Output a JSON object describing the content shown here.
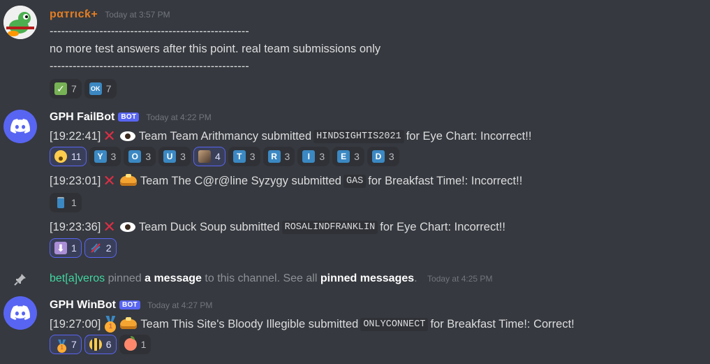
{
  "messages": [
    {
      "author": "pαтrιcƙ+",
      "timestamp": "Today at 3:57 PM",
      "lines": [
        "----------------------------------------------------",
        "no more test answers after this point. real team submissions only",
        "----------------------------------------------------"
      ],
      "reactions": [
        {
          "emoji": "check-mark-icon",
          "count": "7"
        },
        {
          "emoji": "ok-icon",
          "emoji_text": "OK",
          "count": "7"
        }
      ]
    },
    {
      "author": "GPH FailBot",
      "tag": "BOT",
      "timestamp": "Today at 4:22 PM",
      "entries": [
        {
          "time": "[19:22:41]",
          "prefix": "Team Team Arithmancy submitted",
          "answer": "HINDSIGHTIS2021",
          "suffix": "for Eye Chart: Incorrect!!",
          "reactions": [
            {
              "emoji": "surprised-face-icon",
              "count": "11"
            },
            {
              "emoji": "Y",
              "count": "3"
            },
            {
              "emoji": "O",
              "count": "3"
            },
            {
              "emoji": "U",
              "count": "3"
            },
            {
              "emoji": "photo-icon",
              "count": "4"
            },
            {
              "emoji": "T",
              "count": "3"
            },
            {
              "emoji": "R",
              "count": "3"
            },
            {
              "emoji": "I",
              "count": "3"
            },
            {
              "emoji": "E",
              "count": "3"
            },
            {
              "emoji": "D",
              "count": "3"
            }
          ]
        },
        {
          "time": "[19:23:01]",
          "prefix": "Team The C@r@line Syzygy submitted",
          "answer": "GAS",
          "suffix": "for Breakfast Time!: Incorrect!!",
          "reactions": [
            {
              "emoji": "battery-icon",
              "count": "1"
            }
          ]
        },
        {
          "time": "[19:23:36]",
          "prefix": "Team Duck Soup submitted",
          "answer": "ROSALINDFRANKLIN",
          "suffix": "for Eye Chart: Incorrect!!",
          "reactions": [
            {
              "emoji": "down-arrow-icon",
              "count": "1"
            },
            {
              "emoji": "dna-icon",
              "count": "2"
            }
          ]
        }
      ]
    },
    {
      "author": "GPH WinBot",
      "tag": "BOT",
      "timestamp": "Today at 4:27 PM",
      "entries": [
        {
          "time": "[19:27:00]",
          "prefix": "Team This Site's Bloody Illegible submitted",
          "answer": "ONLYCONNECT",
          "suffix": "for Breakfast Time!: Correct!",
          "reactions": [
            {
              "emoji": "first-place-medal-icon",
              "count": "7"
            },
            {
              "emoji": "bee-icon",
              "count": "6"
            },
            {
              "emoji": "peach-icon",
              "count": "1"
            }
          ]
        }
      ]
    }
  ],
  "system": {
    "user": "bet[a]veros",
    "text1": "pinned",
    "link1": "a message",
    "text2": "to this channel. See all",
    "link2": "pinned messages",
    "text3": ".",
    "timestamp": "Today at 4:25 PM"
  },
  "icons": {
    "incorrect": "cross-mark-icon",
    "eye": "eye-icon",
    "pancakes": "pancakes-icon",
    "medal": "first-place-medal-icon",
    "medal_text": "1"
  },
  "colors": {
    "background": "#36393f",
    "blurple": "#5865f2",
    "patrick_name": "#e67e22",
    "system_user": "#41d6a0"
  }
}
